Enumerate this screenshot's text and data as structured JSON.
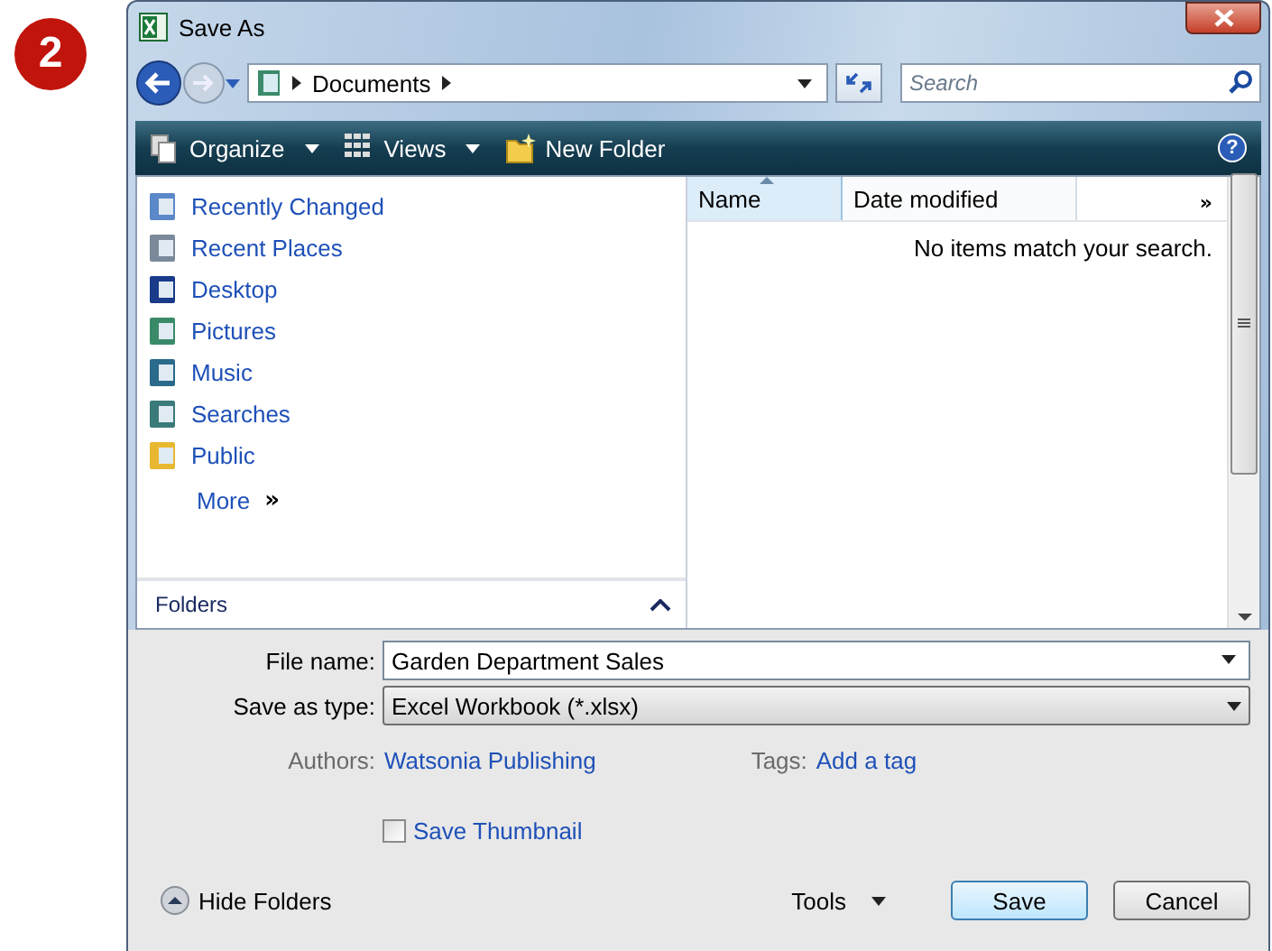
{
  "step_badge": "2",
  "window": {
    "title": "Save As"
  },
  "address_bar": {
    "path": "Documents"
  },
  "search": {
    "placeholder": "Search"
  },
  "help_mark": "?",
  "toolbar": [
    {
      "label": "Organize",
      "dropdown": true
    },
    {
      "label": "Views",
      "dropdown": true
    },
    {
      "label": "New Folder",
      "dropdown": false
    }
  ],
  "sidebar": {
    "items": [
      "Recently Changed",
      "Recent Places",
      "Desktop",
      "Pictures",
      "Music",
      "Searches",
      "Public"
    ],
    "more": "More",
    "more_mark": "»",
    "folders_label": "Folders"
  },
  "file_list": {
    "columns": [
      {
        "label": "Name",
        "sorted": true
      },
      {
        "label": "Date modified",
        "sorted": false
      }
    ],
    "overflow_mark": "»",
    "empty_message": "No items match your search."
  },
  "form": {
    "file_name": {
      "label": "File name:",
      "value": "Garden Department Sales"
    },
    "save_as_type": {
      "label": "Save as type:",
      "value": "Excel Workbook (*.xlsx)"
    },
    "authors": {
      "label": "Authors:",
      "value": "Watsonia Publishing"
    },
    "tags": {
      "label": "Tags:",
      "value": "Add a tag"
    },
    "save_thumbnail": {
      "label": "Save Thumbnail",
      "checked": false
    }
  },
  "footer": {
    "hide_folders": "Hide Folders",
    "tools": "Tools",
    "buttons": [
      {
        "label": "Save",
        "default": true
      },
      {
        "label": "Cancel",
        "default": false
      }
    ]
  }
}
